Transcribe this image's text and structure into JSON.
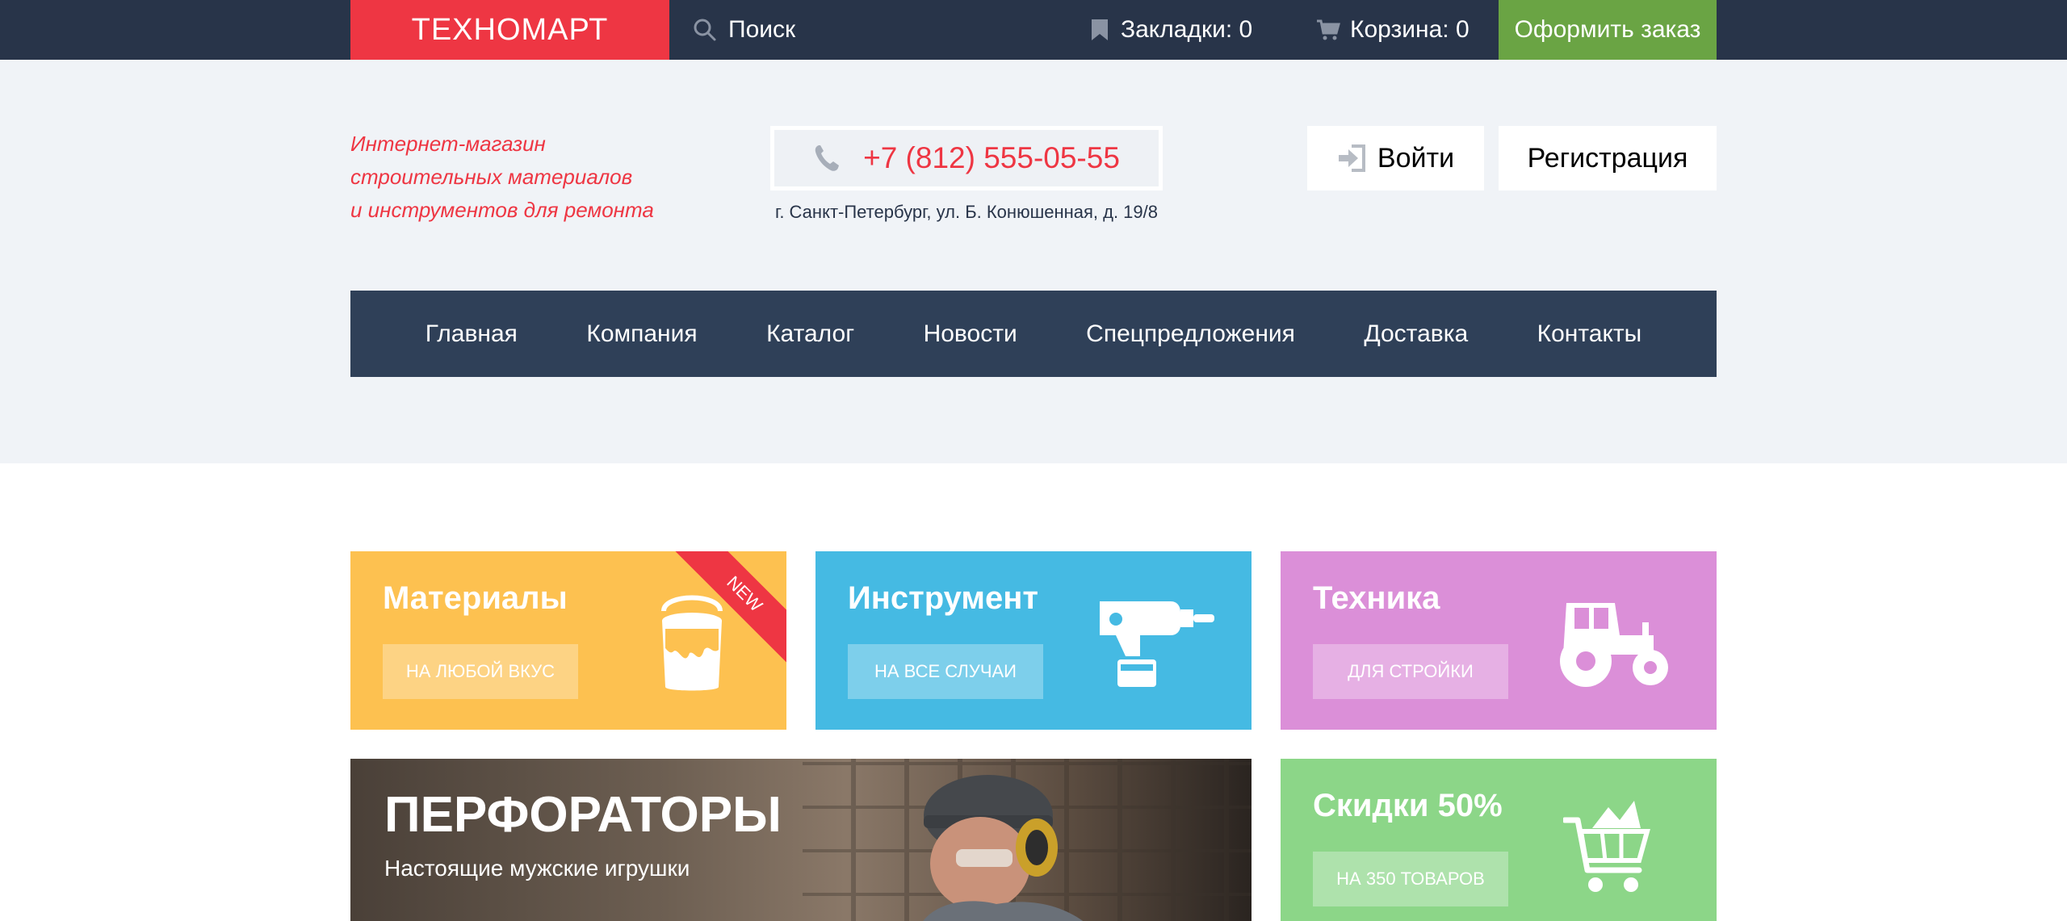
{
  "topbar": {
    "logo": "ТЕХНОМАРТ",
    "search_label": "Поиск",
    "bookmarks_label": "Закладки: 0",
    "cart_label": "Корзина: 0",
    "order_label": "Оформить заказ"
  },
  "header": {
    "tagline_line1": "Интернет-магазин",
    "tagline_line2": "строительных материалов",
    "tagline_line3": "и инструментов для ремонта",
    "phone": "+7 (812) 555-05-55",
    "address": "г. Санкт-Петербург, ул. Б. Конюшенная, д. 19/8",
    "login_label": "Войти",
    "register_label": "Регистрация"
  },
  "nav": {
    "items": [
      "Главная",
      "Компания",
      "Каталог",
      "Новости",
      "Спецпредложения",
      "Доставка",
      "Контакты"
    ]
  },
  "tiles": {
    "materials": {
      "title": "Материалы",
      "button": "На любой вкус",
      "badge": "NEW",
      "color": "#fdc150"
    },
    "tools": {
      "title": "Инструмент",
      "button": "На все случаи",
      "color": "#45bae3"
    },
    "tech": {
      "title": "Техника",
      "button": "Для стройки",
      "color": "#db8fd8"
    },
    "sale": {
      "title": "Скидки 50%",
      "button": "На 350 товаров",
      "color": "#8cd688"
    }
  },
  "promo": {
    "title": "ПЕРФОРАТОРЫ",
    "subtitle": "Настоящие мужские игрушки"
  },
  "colors": {
    "topbar": "#283449",
    "brand_red": "#ee3643",
    "order_green": "#6aa444",
    "nav_bg": "#2f4058",
    "header_bg": "#f0f3f7"
  },
  "icons": [
    "search-icon",
    "bookmark-icon",
    "cart-icon",
    "phone-icon",
    "login-icon",
    "paint-bucket-icon",
    "drill-icon",
    "tractor-icon",
    "shopping-cart-icon"
  ]
}
